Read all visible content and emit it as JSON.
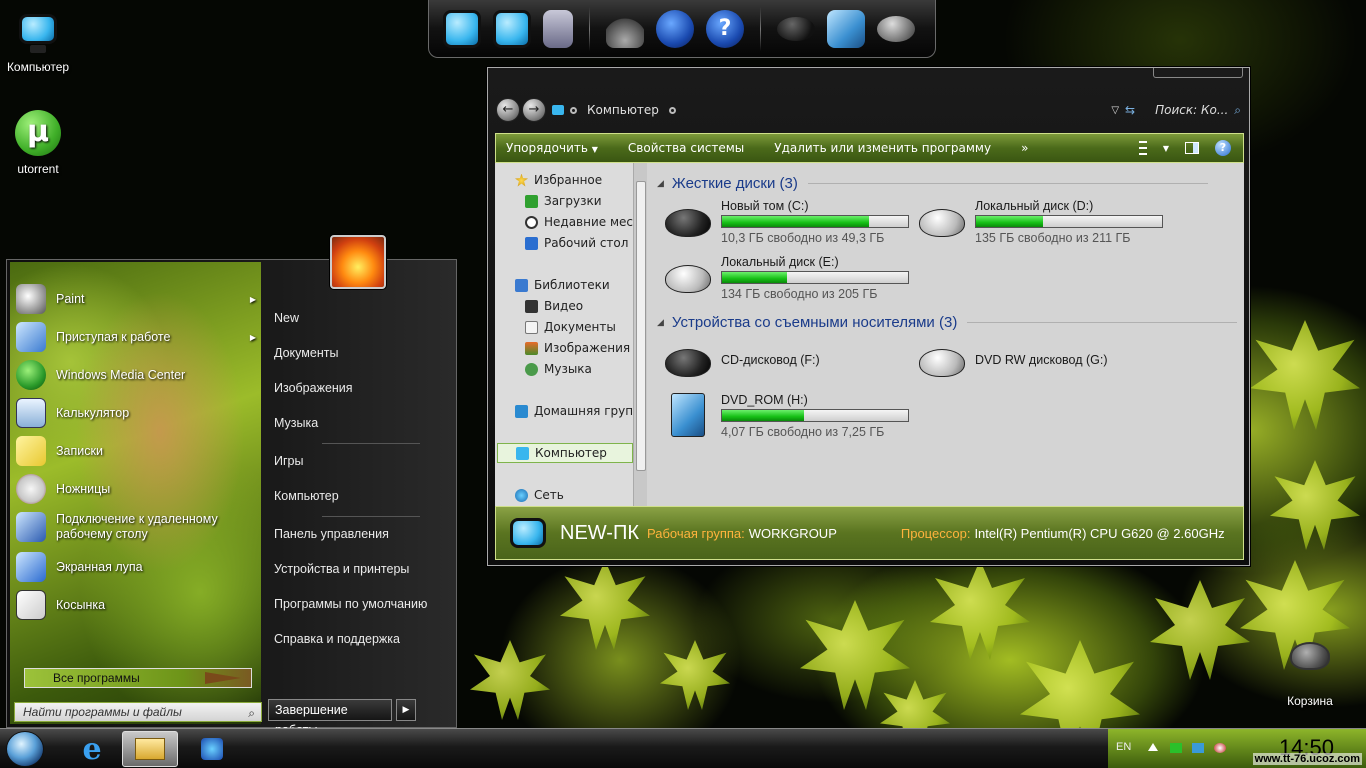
{
  "desktop": {
    "icons": [
      {
        "label": "Компьютер",
        "icon": "computer-icon"
      },
      {
        "label": "utorrent",
        "icon": "utorrent-icon"
      },
      {
        "label": "Корзина",
        "icon": "recycle-bin-icon"
      }
    ]
  },
  "dock": {
    "items": [
      "computer-icon",
      "network-icon",
      "control-panel-icon",
      "joystick-icon",
      "ladybug-icon",
      "help-icon",
      "mouse-icon",
      "folders-icon",
      "drive-icon"
    ]
  },
  "explorer": {
    "address": {
      "back_glyph": "←",
      "forward_glyph": "→",
      "location": "Компьютер",
      "search_placeholder": "Поиск: Ко..."
    },
    "toolbar": {
      "organize": "Упорядочить",
      "system_properties": "Свойства системы",
      "uninstall": "Удалить или изменить программу",
      "more": "»"
    },
    "nav": {
      "favorites": "Избранное",
      "downloads": "Загрузки",
      "recent": "Недавние места",
      "desktop": "Рабочий стол",
      "libraries": "Библиотеки",
      "video": "Видео",
      "documents": "Документы",
      "pictures": "Изображения",
      "music": "Музыка",
      "homegroup": "Домашняя группа",
      "computer": "Компьютер",
      "network": "Сеть"
    },
    "groups": {
      "hard_drives": "Жесткие диски (3)",
      "removable": "Устройства со съемными носителями (3)"
    },
    "drives": [
      {
        "name": "Новый том (C:)",
        "free": "10,3 ГБ свободно из 49,3 ГБ",
        "used_fraction": 0.79
      },
      {
        "name": "Локальный диск (D:)",
        "free": "135 ГБ свободно из 211 ГБ",
        "used_fraction": 0.36
      },
      {
        "name": "Локальный диск (E:)",
        "free": "134 ГБ свободно из 205 ГБ",
        "used_fraction": 0.35
      },
      {
        "name": "CD-дисковод (F:)"
      },
      {
        "name": "DVD RW дисковод (G:)"
      },
      {
        "name": "DVD_ROM (H:)",
        "free": "4,07 ГБ свободно из 7,25 ГБ",
        "used_fraction": 0.44
      }
    ],
    "details": {
      "pc_name": "NEW-ПК",
      "workgroup_label": "Рабочая группа:",
      "workgroup_value": "WORKGROUP",
      "cpu_label": "Процессор:",
      "cpu_value": "Intel(R) Pentium(R) CPU G620 @ 2.60GHz"
    }
  },
  "start_menu": {
    "programs": [
      {
        "label": "Paint",
        "has_arrow": true
      },
      {
        "label": "Приступая к работе",
        "has_arrow": true
      },
      {
        "label": "Windows Media Center"
      },
      {
        "label": "Калькулятор"
      },
      {
        "label": "Записки"
      },
      {
        "label": "Ножницы"
      },
      {
        "label": "Подключение к удаленному рабочему столу"
      },
      {
        "label": "Экранная лупа"
      },
      {
        "label": "Косынка"
      }
    ],
    "all_programs": "Все программы",
    "search_placeholder": "Найти программы и файлы",
    "right_links": [
      "New",
      "Документы",
      "Изображения",
      "Музыка",
      "Игры",
      "Компьютер",
      "Панель управления",
      "Устройства и принтеры",
      "Программы по умолчанию",
      "Справка и поддержка"
    ],
    "shutdown": "Завершение работы"
  },
  "taskbar": {
    "lang": "EN",
    "clock": "14:50",
    "watermark": "www.tt-76.ucoz.com"
  }
}
